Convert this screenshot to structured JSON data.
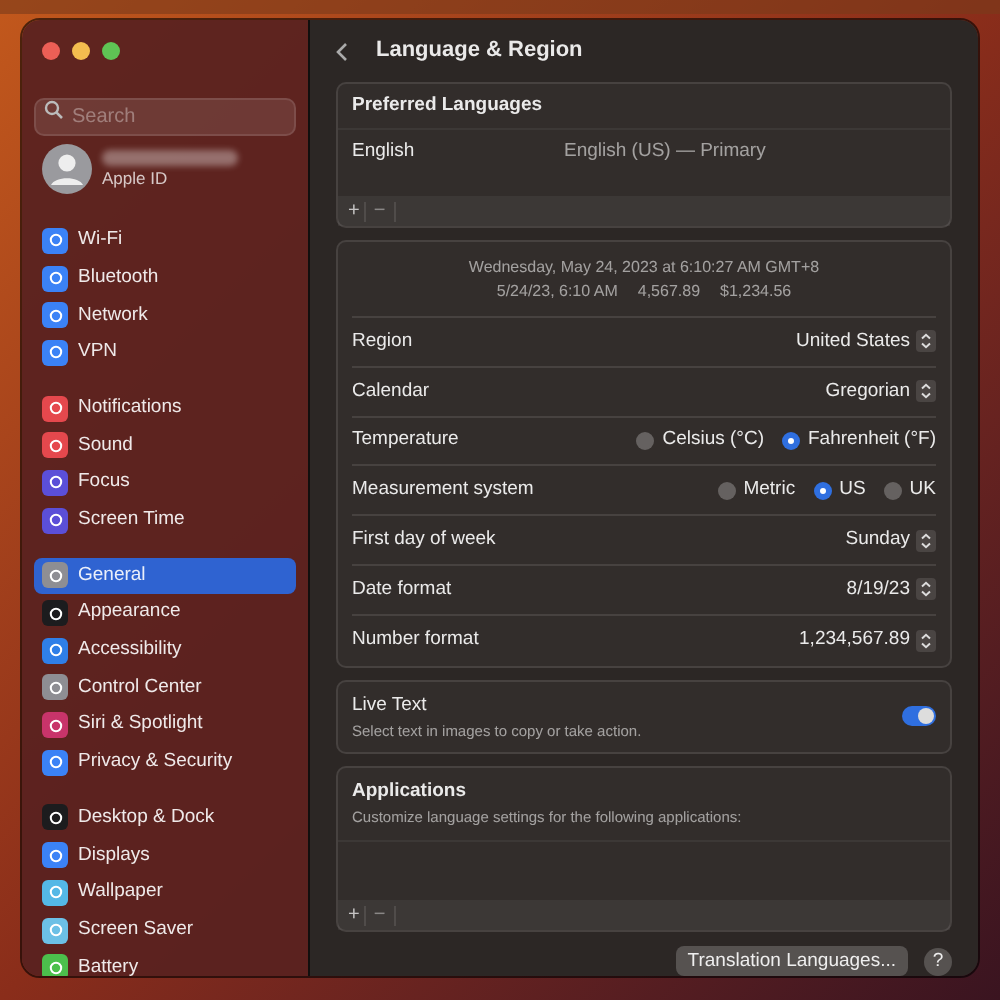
{
  "sidebar": {
    "search": {
      "placeholder": "Search"
    },
    "account": {
      "subtitle": "Apple ID"
    },
    "groups": [
      [
        {
          "label": "Wi-Fi",
          "selected": false
        },
        {
          "label": "Bluetooth",
          "selected": false
        },
        {
          "label": "Network",
          "selected": false
        },
        {
          "label": "VPN",
          "selected": false
        }
      ],
      [
        {
          "label": "Notifications",
          "selected": false
        },
        {
          "label": "Sound",
          "selected": false
        },
        {
          "label": "Focus",
          "selected": false
        },
        {
          "label": "Screen Time",
          "selected": false
        }
      ],
      [
        {
          "label": "General",
          "selected": true
        },
        {
          "label": "Appearance",
          "selected": false
        },
        {
          "label": "Accessibility",
          "selected": false
        },
        {
          "label": "Control Center",
          "selected": false
        },
        {
          "label": "Siri & Spotlight",
          "selected": false
        },
        {
          "label": "Privacy & Security",
          "selected": false
        }
      ],
      [
        {
          "label": "Desktop & Dock",
          "selected": false
        },
        {
          "label": "Displays",
          "selected": false
        },
        {
          "label": "Wallpaper",
          "selected": false
        },
        {
          "label": "Screen Saver",
          "selected": false
        },
        {
          "label": "Battery",
          "selected": false
        }
      ]
    ]
  },
  "header": {
    "title": "Language & Region"
  },
  "preferred_languages": {
    "title": "Preferred Languages",
    "languages": [
      {
        "name": "English",
        "detail": "English (US) — Primary"
      }
    ],
    "add": "+",
    "remove": "−"
  },
  "format_preview": [
    "Wednesday, May 24, 2023 at 6:10:27 AM GMT+8",
    "5/24/23, 6:10 AM",
    "4,567.89",
    "$1,234.56"
  ],
  "settings": [
    {
      "kind": "popup",
      "label": "Region",
      "value": "United States"
    },
    {
      "kind": "popup",
      "label": "Calendar",
      "value": "Gregorian"
    },
    {
      "kind": "radio",
      "label": "Temperature",
      "options": [
        {
          "label": "Celsius (°C)",
          "selected": false
        },
        {
          "label": "Fahrenheit (°F)",
          "selected": true
        }
      ]
    },
    {
      "kind": "radio",
      "label": "Measurement system",
      "options": [
        {
          "label": "Metric",
          "selected": false
        },
        {
          "label": "US",
          "selected": true
        },
        {
          "label": "UK",
          "selected": false
        }
      ]
    },
    {
      "kind": "popup",
      "label": "First day of week",
      "value": "Sunday"
    },
    {
      "kind": "popup",
      "label": "Date format",
      "value": "8/19/23"
    },
    {
      "kind": "popup",
      "label": "Number format",
      "value": "1,234,567.89"
    }
  ],
  "live_text": {
    "title": "Live Text",
    "description": "Select text in images to copy or take action.",
    "on": true
  },
  "applications": {
    "title": "Applications",
    "description": "Customize language settings for the following applications:",
    "add": "+",
    "remove": "−"
  },
  "buttons": {
    "translation": "Translation Languages...",
    "help": "?"
  }
}
